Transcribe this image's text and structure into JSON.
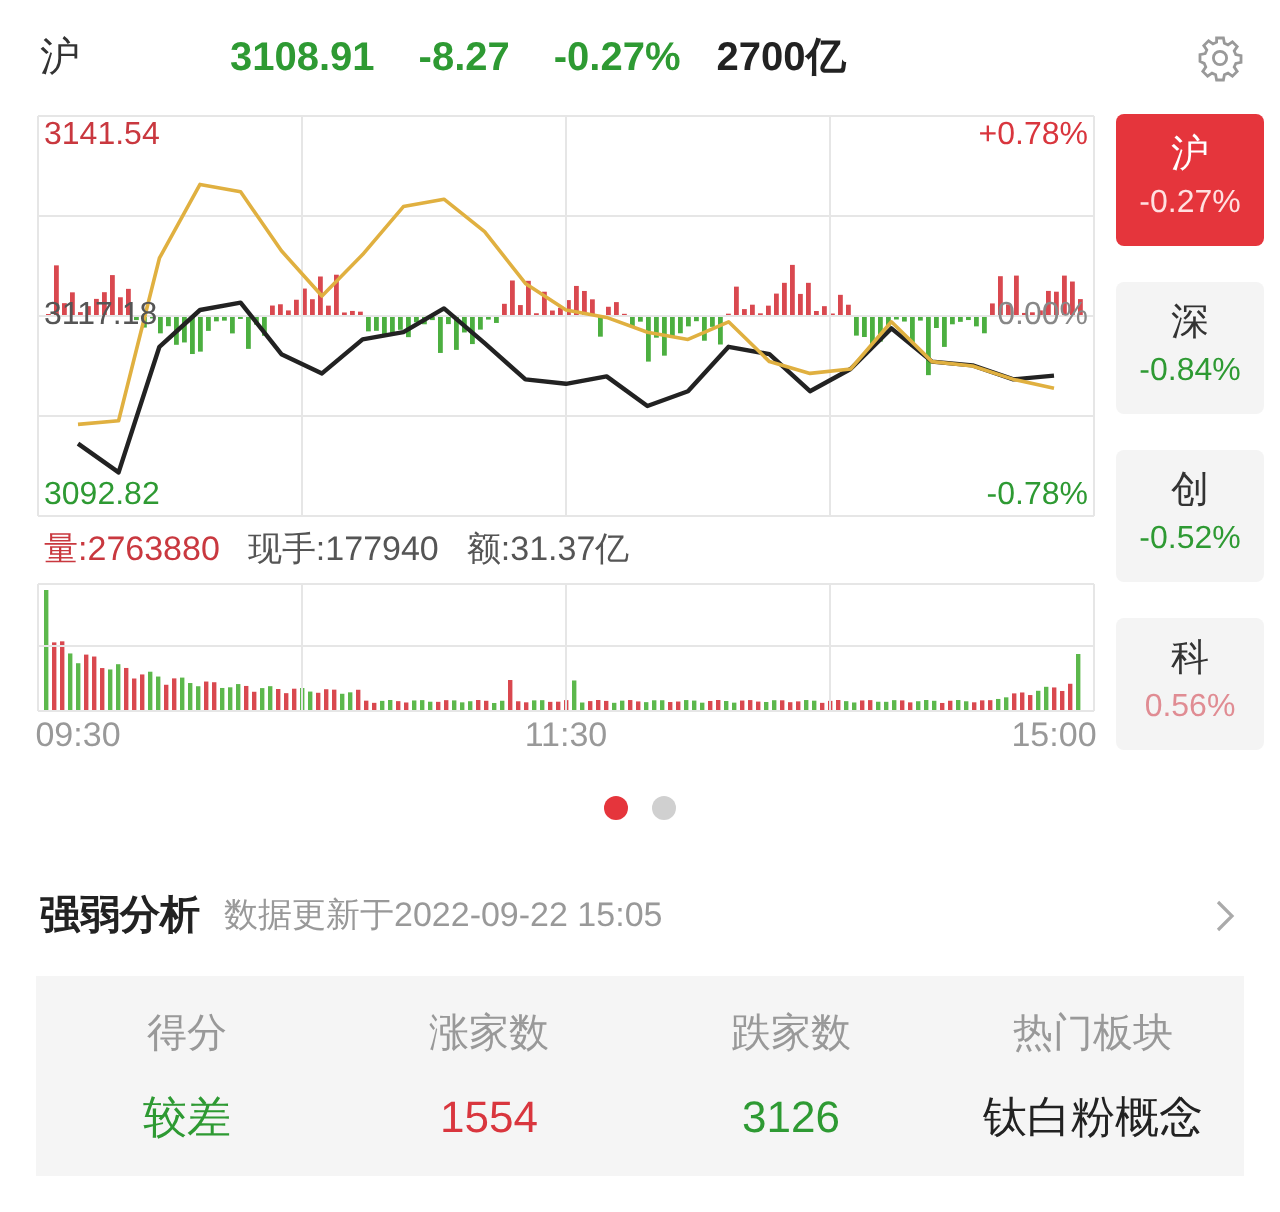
{
  "header": {
    "index_name": "沪",
    "price": "3108.91",
    "change": "-8.27",
    "change_pct": "-0.27%",
    "turnover": "2700亿",
    "color": "#2e9a33"
  },
  "chart": {
    "chart_data": {
      "type": "line",
      "categories": [
        "09:30",
        null,
        null,
        null,
        null,
        null,
        null,
        null,
        null,
        null,
        null,
        null,
        "11:30",
        null,
        null,
        null,
        null,
        null,
        null,
        null,
        null,
        null,
        null,
        null,
        "15:00"
      ],
      "series": [
        {
          "color": "#222222",
          "values": [
            3099.9,
            3096,
            3113,
            3118,
            3119,
            3112,
            3109.4,
            3114,
            3115,
            3118.2,
            3113.5,
            3108.6,
            3108,
            3109,
            3105,
            3107,
            3113,
            3112,
            3107,
            3110,
            3115.5,
            3111,
            3110.5,
            3108.6,
            3109.1
          ]
        },
        {
          "color": "#e0b040",
          "values": [
            3102.5,
            3103,
            3125,
            3135,
            3134,
            3126,
            3119.9,
            3125.5,
            3132,
            3133,
            3128.6,
            3121.6,
            3118,
            3117,
            3115,
            3114,
            3116.4,
            3111,
            3109.4,
            3110,
            3116.4,
            3111,
            3110.4,
            3108.6,
            3107.4
          ]
        }
      ],
      "ylim": [
        3090.11,
        3144.25
      ],
      "yticks": [
        {
          "value": 3141.54,
          "label": "3141.54"
        },
        {
          "value": 3117.18,
          "label": "3117.18"
        },
        {
          "value": 3092.82,
          "label": "3092.82"
        }
      ]
    },
    "right_labels": [
      {
        "text": "+0.78%",
        "color": "#d9363e"
      },
      {
        "text": "0.00%",
        "color": "#888888"
      },
      {
        "text": "-0.78%",
        "color": "#2e9a33"
      }
    ],
    "volume_stats": [
      {
        "label": "量:",
        "value": "2763880",
        "kind": "volume"
      },
      {
        "label": "现手:",
        "value": "177940",
        "kind": "plain"
      },
      {
        "label": "额:",
        "value": "31.37亿",
        "kind": "plain"
      }
    ]
  },
  "market_tabs": [
    {
      "label": "沪",
      "change_pct": "-0.27%",
      "color": "#ffe0e0",
      "selected": true
    },
    {
      "label": "深",
      "change_pct": "-0.84%",
      "color": "#2e9a33",
      "selected": false
    },
    {
      "label": "创",
      "change_pct": "-0.52%",
      "color": "#2e9a33",
      "selected": false
    },
    {
      "label": "科",
      "change_pct": "0.56%",
      "color": "#e08c93",
      "selected": false
    }
  ],
  "page_dots": [
    {
      "selected": true
    },
    {
      "selected": false
    }
  ],
  "analysis": {
    "title": "强弱分析",
    "updated": "数据更新于2022-09-22 15:05",
    "columns": [
      {
        "header": "得分",
        "value": "较差",
        "color": "#2e9a33"
      },
      {
        "header": "涨家数",
        "value": "1554",
        "color": "#d9363e"
      },
      {
        "header": "跌家数",
        "value": "3126",
        "color": "#2e9a33"
      },
      {
        "header": "热门板块",
        "value": "钛白粉概念",
        "color": "#222222"
      }
    ]
  }
}
